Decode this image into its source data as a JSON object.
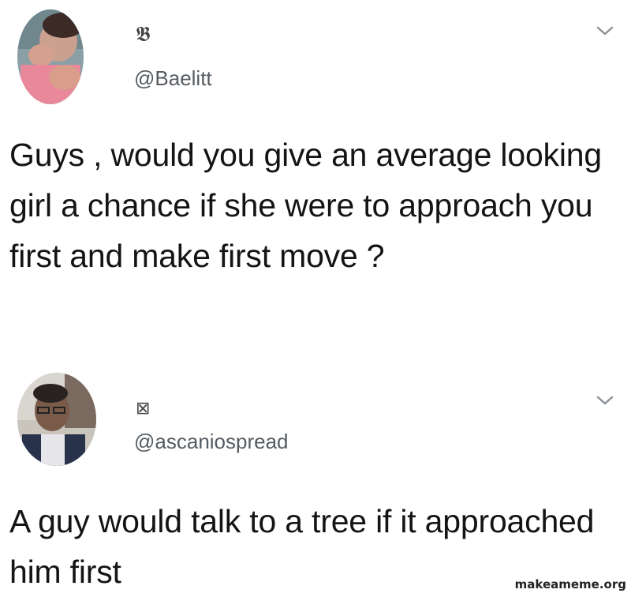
{
  "posts": [
    {
      "display_name": "𝕭",
      "handle": "@Baelitt",
      "text": "Guys , would you give an average looking girl a chance if she were to approach you first and make first move ?"
    },
    {
      "display_name": "⊠",
      "handle": "@ascaniospread",
      "text": "A guy would talk to a tree if it approached him first"
    }
  ],
  "icons": {
    "menu": "chevron-down-icon"
  },
  "watermark": "makeameme.org"
}
